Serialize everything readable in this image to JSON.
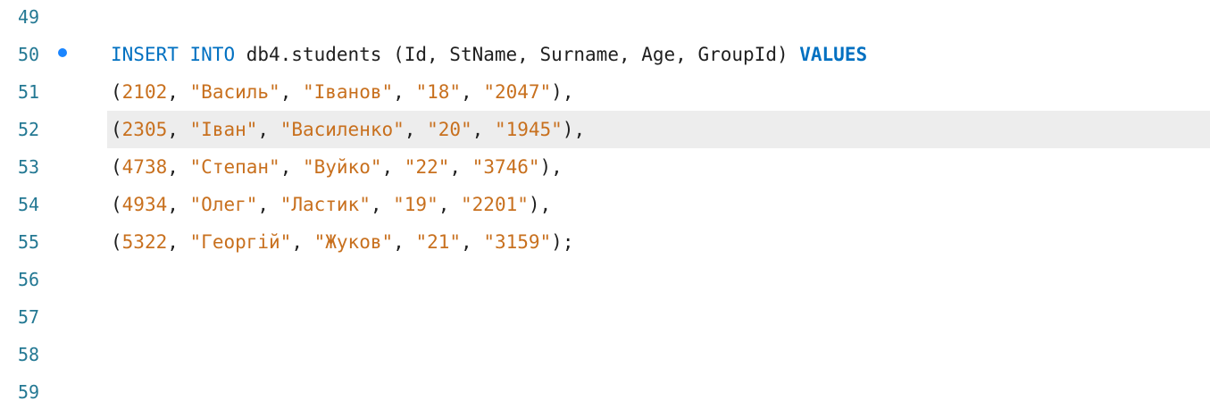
{
  "editor": {
    "current_line": 52,
    "breakpoint_line": 50,
    "lines": [
      {
        "number": "49",
        "tokens": []
      },
      {
        "number": "50",
        "tokens": [
          {
            "t": "INSERT",
            "c": "kw2"
          },
          {
            "t": " ",
            "c": "punct"
          },
          {
            "t": "INTO",
            "c": "kw2"
          },
          {
            "t": " db4.students (Id, StName, Surname, Age, GroupId) ",
            "c": "punct"
          },
          {
            "t": "VALUES",
            "c": "kw"
          }
        ]
      },
      {
        "number": "51",
        "tokens": [
          {
            "t": "(",
            "c": "punct"
          },
          {
            "t": "2102",
            "c": "str"
          },
          {
            "t": ", ",
            "c": "punct"
          },
          {
            "t": "\"Василь\"",
            "c": "str"
          },
          {
            "t": ", ",
            "c": "punct"
          },
          {
            "t": "\"Іванов\"",
            "c": "str"
          },
          {
            "t": ", ",
            "c": "punct"
          },
          {
            "t": "\"18\"",
            "c": "str"
          },
          {
            "t": ", ",
            "c": "punct"
          },
          {
            "t": "\"2047\"",
            "c": "str"
          },
          {
            "t": "),",
            "c": "punct"
          }
        ]
      },
      {
        "number": "52",
        "tokens": [
          {
            "t": "(",
            "c": "punct"
          },
          {
            "t": "2305",
            "c": "str"
          },
          {
            "t": ", ",
            "c": "punct"
          },
          {
            "t": "\"Іван\"",
            "c": "str"
          },
          {
            "t": ", ",
            "c": "punct"
          },
          {
            "t": "\"Василенко\"",
            "c": "str"
          },
          {
            "t": ", ",
            "c": "punct"
          },
          {
            "t": "\"20\"",
            "c": "str"
          },
          {
            "t": ", ",
            "c": "punct"
          },
          {
            "t": "\"1945\"",
            "c": "str"
          },
          {
            "t": "),",
            "c": "punct"
          }
        ]
      },
      {
        "number": "53",
        "tokens": [
          {
            "t": "(",
            "c": "punct"
          },
          {
            "t": "4738",
            "c": "str"
          },
          {
            "t": ", ",
            "c": "punct"
          },
          {
            "t": "\"Степан\"",
            "c": "str"
          },
          {
            "t": ", ",
            "c": "punct"
          },
          {
            "t": "\"Вуйко\"",
            "c": "str"
          },
          {
            "t": ", ",
            "c": "punct"
          },
          {
            "t": "\"22\"",
            "c": "str"
          },
          {
            "t": ", ",
            "c": "punct"
          },
          {
            "t": "\"3746\"",
            "c": "str"
          },
          {
            "t": "),",
            "c": "punct"
          }
        ]
      },
      {
        "number": "54",
        "tokens": [
          {
            "t": "(",
            "c": "punct"
          },
          {
            "t": "4934",
            "c": "str"
          },
          {
            "t": ", ",
            "c": "punct"
          },
          {
            "t": "\"Олег\"",
            "c": "str"
          },
          {
            "t": ", ",
            "c": "punct"
          },
          {
            "t": "\"Ластик\"",
            "c": "str"
          },
          {
            "t": ", ",
            "c": "punct"
          },
          {
            "t": "\"19\"",
            "c": "str"
          },
          {
            "t": ", ",
            "c": "punct"
          },
          {
            "t": "\"2201\"",
            "c": "str"
          },
          {
            "t": "),",
            "c": "punct"
          }
        ]
      },
      {
        "number": "55",
        "tokens": [
          {
            "t": "(",
            "c": "punct"
          },
          {
            "t": "5322",
            "c": "str"
          },
          {
            "t": ", ",
            "c": "punct"
          },
          {
            "t": "\"Георгій\"",
            "c": "str"
          },
          {
            "t": ", ",
            "c": "punct"
          },
          {
            "t": "\"Жуков\"",
            "c": "str"
          },
          {
            "t": ", ",
            "c": "punct"
          },
          {
            "t": "\"21\"",
            "c": "str"
          },
          {
            "t": ", ",
            "c": "punct"
          },
          {
            "t": "\"3159\"",
            "c": "str"
          },
          {
            "t": ");",
            "c": "punct"
          }
        ]
      },
      {
        "number": "56",
        "tokens": []
      },
      {
        "number": "57",
        "tokens": []
      },
      {
        "number": "58",
        "tokens": []
      },
      {
        "number": "59",
        "tokens": []
      }
    ]
  },
  "colors": {
    "line_number": "#237893",
    "keyword": "#0070c1",
    "string": "#c8701e",
    "current_line_bg": "#ededed",
    "breakpoint": "#1a85ff"
  }
}
